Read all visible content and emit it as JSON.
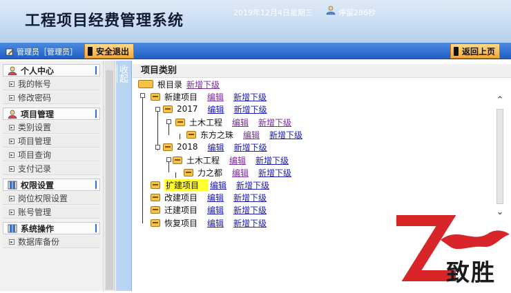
{
  "header": {
    "title": "工程项目经费管理系统",
    "date": "2019年12月4日",
    "weekday": "星期三",
    "stay": "停留286秒"
  },
  "toolbar": {
    "admin_label": "管理员［管理员］",
    "exit_label": "安全退出",
    "back_label": "返回上页"
  },
  "sidebar": {
    "groups": [
      {
        "label": "个人中心",
        "items": [
          "我的帐号",
          "修改密码"
        ]
      },
      {
        "label": "项目管理",
        "items": [
          "类别设置",
          "项目管理",
          "项目查询",
          "支付记录"
        ]
      },
      {
        "label": "权限设置",
        "items": [
          "岗位权限设置",
          "账号管理"
        ]
      },
      {
        "label": "系统操作",
        "items": [
          "数据库备份"
        ]
      }
    ]
  },
  "collapse_label": "收起",
  "main": {
    "heading": "项目类别",
    "root_label": "根目录",
    "edit_label": "编辑",
    "add_child_label": "新增下级",
    "tree": [
      {
        "label": "新建项目"
      },
      {
        "label": "2017"
      },
      {
        "label": "土木工程"
      },
      {
        "label": "东方之珠"
      },
      {
        "label": "2018"
      },
      {
        "label": "土木工程"
      },
      {
        "label": "力之都"
      },
      {
        "label": "扩建项目"
      },
      {
        "label": "改建项目"
      },
      {
        "label": "迁建项目"
      },
      {
        "label": "恢复项目"
      }
    ]
  },
  "logo": {
    "text": "致胜",
    "letter": "Z",
    "accent_color": "#d8252a"
  }
}
